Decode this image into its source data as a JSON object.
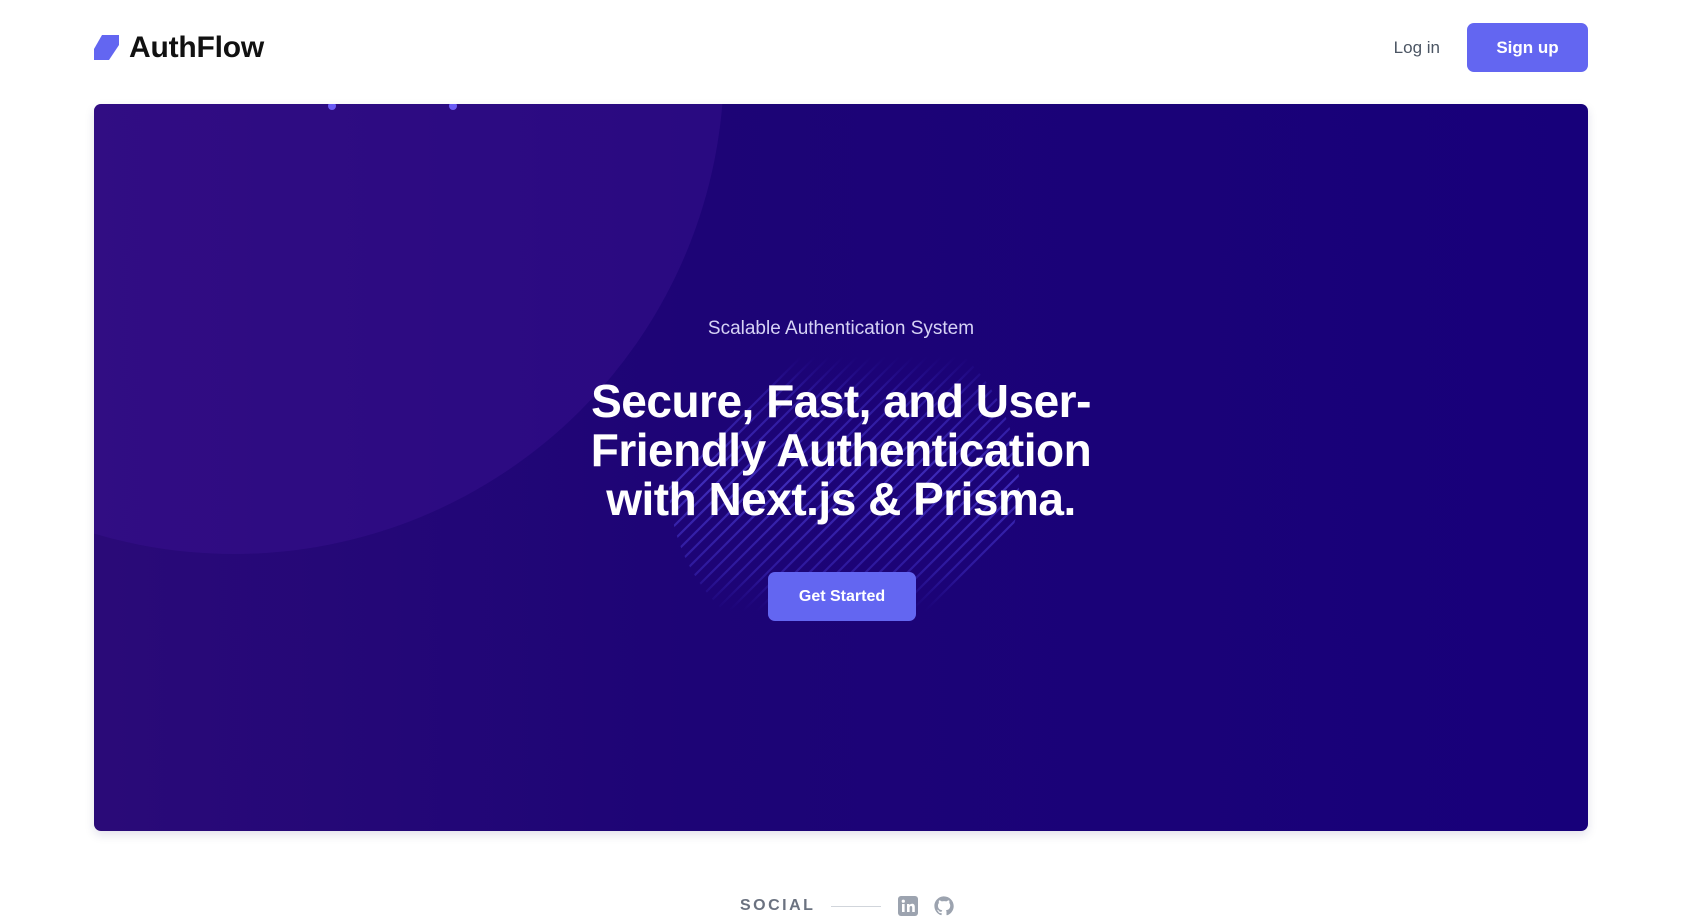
{
  "header": {
    "brand_name": "AuthFlow",
    "login_label": "Log in",
    "signup_label": "Sign up"
  },
  "hero": {
    "eyebrow": "Scalable Authentication System",
    "title": "Secure, Fast, and User-Friendly Authentication with Next.js & Prisma.",
    "cta_label": "Get Started"
  },
  "social": {
    "label": "SOCIAL",
    "icons": [
      "linkedin-icon",
      "github-icon"
    ]
  },
  "colors": {
    "accent": "#6366f1",
    "hero_bg": "#17007a",
    "text_dark": "#111111",
    "text_muted": "#6b7280"
  }
}
